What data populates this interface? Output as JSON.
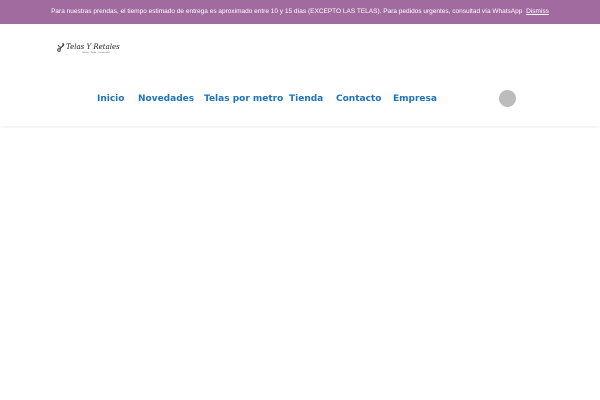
{
  "notice": {
    "text": "Para nuestras prendas, el tiempo estimado de entrega es aproximado entre 10 y 15 días (EXCEPTO LAS TELAS). Para pedidos urgentes, consultad vía WhatsApp",
    "dismiss_label": "Dismiss",
    "background_color": "#a26b9f"
  },
  "header": {
    "logo_text": "Telas Y Retales",
    "logo_tagline": "Diseño · Moda · Creatividad"
  },
  "nav": {
    "items": [
      {
        "label": "Inicio"
      },
      {
        "label": "Novedades"
      },
      {
        "label": "Telas por metro"
      },
      {
        "label": "Tienda"
      },
      {
        "label": "Contacto"
      },
      {
        "label": "Empresa"
      }
    ],
    "link_color": "#1e73be"
  },
  "search": {
    "icon": "search-icon"
  }
}
